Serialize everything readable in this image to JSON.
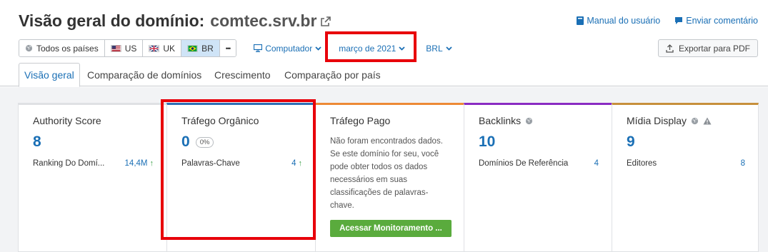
{
  "header": {
    "title": "Visão geral do domínio:",
    "domain": "comtec.srv.br"
  },
  "top_links": {
    "manual": "Manual do usuário",
    "feedback": "Enviar comentário"
  },
  "filters": {
    "countries": [
      {
        "label": "Todos os países",
        "icon": "globe-icon"
      },
      {
        "label": "US",
        "icon": "flag-us"
      },
      {
        "label": "UK",
        "icon": "flag-uk"
      },
      {
        "label": "BR",
        "icon": "flag-br",
        "active": true
      },
      {
        "label": "•••",
        "icon": "more-icon"
      }
    ],
    "device": "Computador",
    "date": "março de 2021",
    "currency": "BRL",
    "export": "Exportar para PDF"
  },
  "tabs": [
    {
      "label": "Visão geral",
      "active": true
    },
    {
      "label": "Comparação de domínios"
    },
    {
      "label": "Crescimento"
    },
    {
      "label": "Comparação por país"
    }
  ],
  "cards": {
    "authority": {
      "title": "Authority Score",
      "value": "8",
      "sub_label": "Ranking Do Domí...",
      "sub_value": "14,4M",
      "accent": "#dfe1e4"
    },
    "organic": {
      "title": "Tráfego Orgânico",
      "value": "0",
      "badge": "0%",
      "sub_label": "Palavras-Chave",
      "sub_value": "4",
      "accent": "#2e6fb5"
    },
    "paid": {
      "title": "Tráfego Pago",
      "text": "Não foram encontrados dados. Se este domínio for seu, você pode obter todos os dados necessários em suas classificações de palavras-chave.",
      "button": "Acessar Monitoramento ...",
      "accent": "#ed8a36"
    },
    "backlinks": {
      "title": "Backlinks",
      "value": "10",
      "sub_label": "Domínios De Referência",
      "sub_value": "4",
      "accent": "#8a2bc2"
    },
    "display": {
      "title": "Mídia Display",
      "value": "9",
      "sub_label": "Editores",
      "sub_value": "8",
      "accent": "#c7903c"
    }
  },
  "colors": {
    "link": "#1a6fb5",
    "highlight": "#e8000a",
    "button_green": "#5aab3d"
  }
}
